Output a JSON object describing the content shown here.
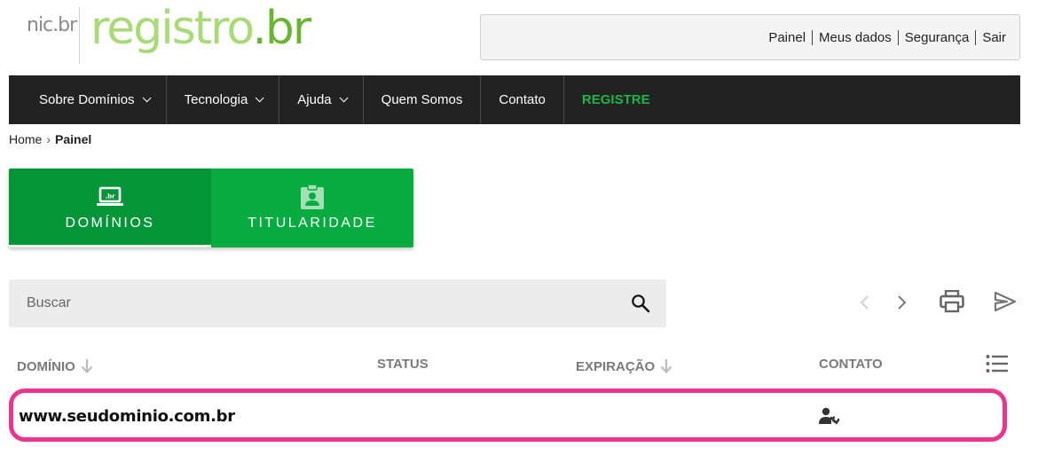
{
  "logo": {
    "nic": "nic.br",
    "registro_main": "registro",
    "registro_ext": ".br"
  },
  "toplinks": [
    "Painel",
    "Meus dados",
    "Segurança",
    "Sair"
  ],
  "nav": {
    "items": [
      {
        "label": "Sobre Domínios",
        "dropdown": true
      },
      {
        "label": "Tecnologia",
        "dropdown": true
      },
      {
        "label": "Ajuda",
        "dropdown": true
      },
      {
        "label": "Quem Somos",
        "dropdown": false
      },
      {
        "label": "Contato",
        "dropdown": false
      }
    ],
    "cta": "REGISTRE",
    "cta_color": "#1fb34a"
  },
  "breadcrumb": {
    "home": "Home",
    "separator": "›",
    "current": "Painel"
  },
  "tabs": [
    {
      "label": "DOMÍNIOS",
      "icon": "laptop-br-icon",
      "active": true
    },
    {
      "label": "TITULARIDADE",
      "icon": "badge-person-icon",
      "active": false
    }
  ],
  "search": {
    "placeholder": "Buscar",
    "value": ""
  },
  "toolbar": {
    "icons": [
      "chevron-left-icon",
      "chevron-right-icon",
      "print-icon",
      "send-icon"
    ]
  },
  "table": {
    "columns": [
      {
        "label": "DOMÍNIO",
        "sortable": true
      },
      {
        "label": "STATUS",
        "sortable": false
      },
      {
        "label": "EXPIRAÇÃO",
        "sortable": true
      },
      {
        "label": "CONTATO",
        "sortable": false
      }
    ],
    "rows": [
      {
        "domain": "www.seudominio.com.br",
        "status": "",
        "expiracao": "",
        "contato_icon": "user-wrench-icon"
      }
    ],
    "highlight_color": "#e8358d"
  },
  "colors": {
    "brand_green": "#07ac41",
    "brand_green_dark": "#059539",
    "nav_bg": "#222222"
  }
}
